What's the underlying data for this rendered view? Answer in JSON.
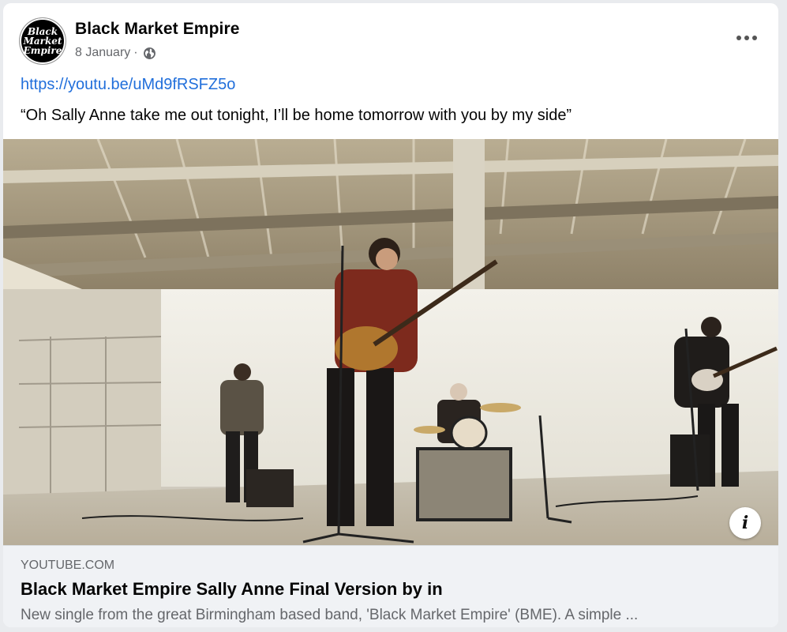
{
  "post": {
    "author": "Black Market Empire",
    "avatar_text": [
      "Black",
      "Market",
      "Empire"
    ],
    "date": "8 January",
    "separator": "·",
    "privacy_icon": "globe-icon",
    "more_icon": "more-options-icon",
    "link": "https://youtu.be/uMd9fRSFZ5o",
    "caption": "“Oh Sally Anne take me out tonight, I’ll be home tomorrow with you by my side”"
  },
  "preview": {
    "domain": "YOUTUBE.COM",
    "title": "Black Market Empire Sally Anne Final Version by in",
    "description": "New single from the great Birmingham based band, 'Black Market Empire' (BME). A simple ...",
    "info_icon": "i"
  },
  "colors": {
    "link": "#216fdb",
    "secondary_text": "#65676b",
    "preview_bg": "#f0f2f5"
  }
}
